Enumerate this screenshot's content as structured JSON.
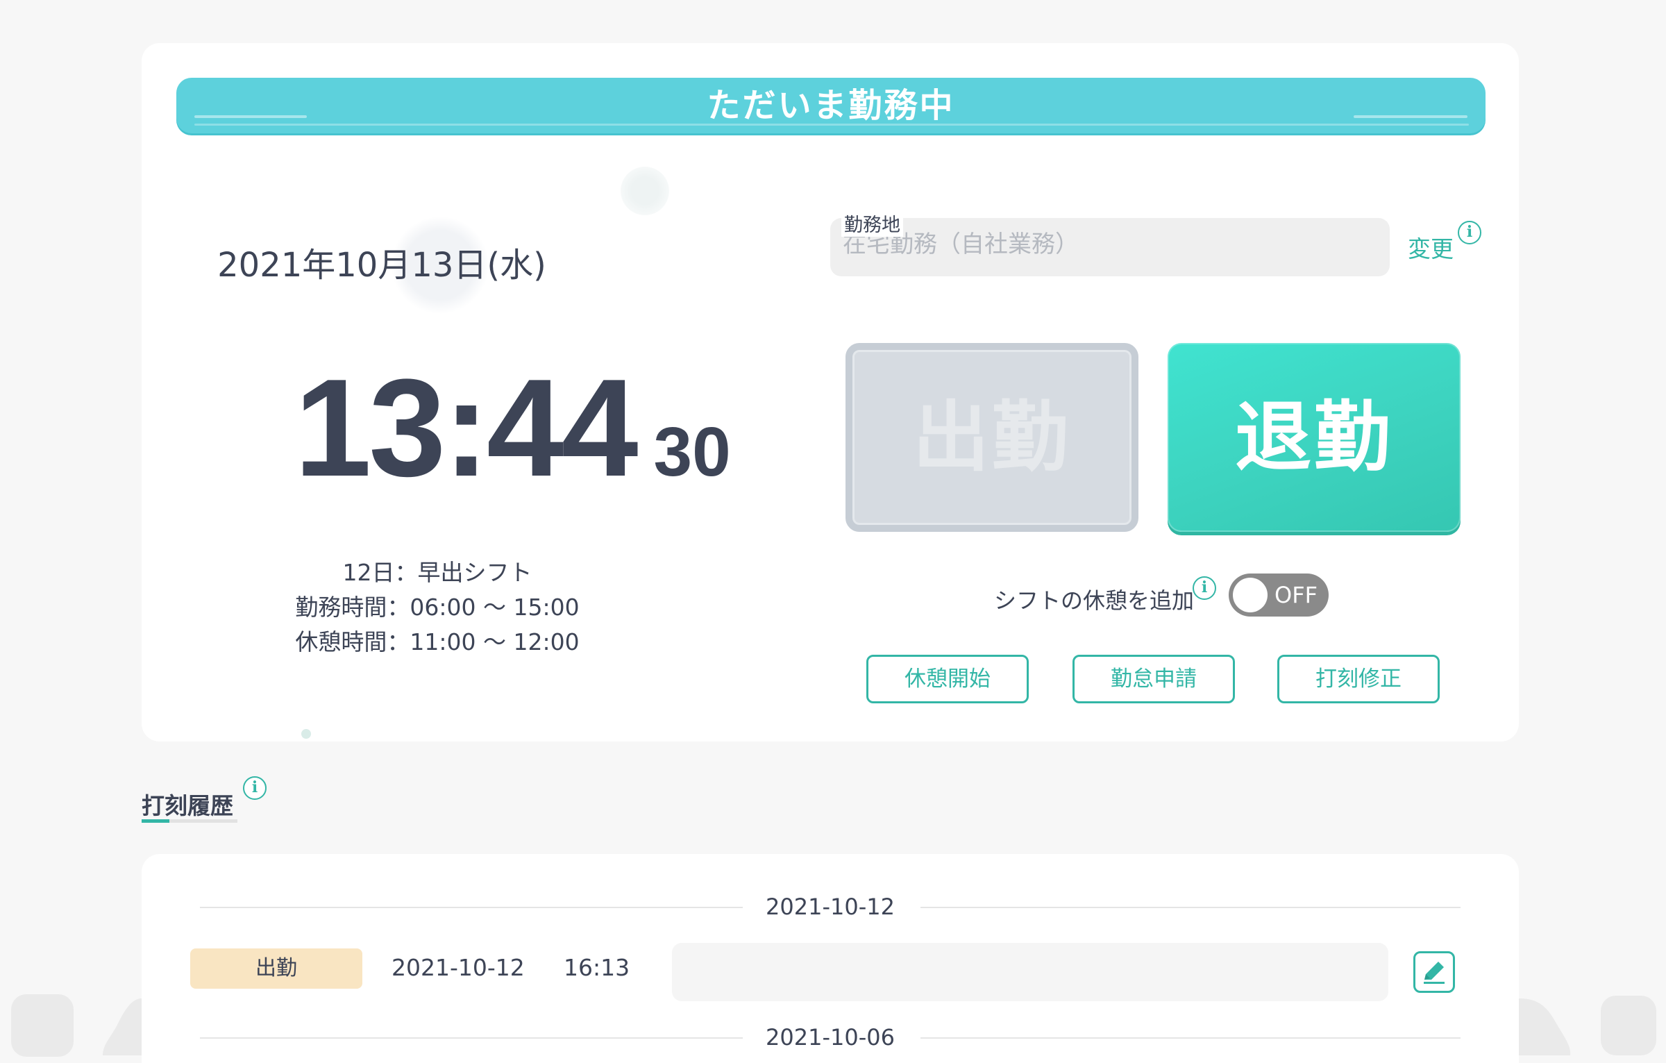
{
  "status": {
    "title": "ただいま勤務中"
  },
  "clock": {
    "date": "2021年10月13日(水)",
    "hours_minutes": "13:44",
    "seconds": "30"
  },
  "shift": {
    "line1": "12日：早出シフト",
    "line2": "勤務時間：06:00 〜 15:00",
    "line3": "休憩時間：11:00 〜 12:00"
  },
  "location": {
    "label": "勤務地",
    "value": "在宅勤務（自社業務）",
    "change_label": "変更"
  },
  "punch": {
    "clock_in_label": "出勤",
    "clock_out_label": "退勤"
  },
  "break_toggle": {
    "label": "シフトの休憩を追加",
    "state_text": "OFF"
  },
  "actions": {
    "break_start": "休憩開始",
    "attendance_request": "勤怠申請",
    "punch_correction": "打刻修正"
  },
  "history": {
    "title": "打刻履歴",
    "groups": [
      {
        "date": "2021-10-12",
        "records": [
          {
            "type": "出勤",
            "date": "2021-10-12",
            "time": "16:13",
            "note": ""
          }
        ]
      },
      {
        "date": "2021-10-06",
        "records": []
      }
    ]
  },
  "colors": {
    "accent": "#33b6a6",
    "banner": "#5dd1dc",
    "clock_out": "#3dd3bf",
    "badge_clock_in": "#f9e5c2"
  },
  "icons": {
    "info": "info-icon",
    "edit": "pencil-icon"
  }
}
